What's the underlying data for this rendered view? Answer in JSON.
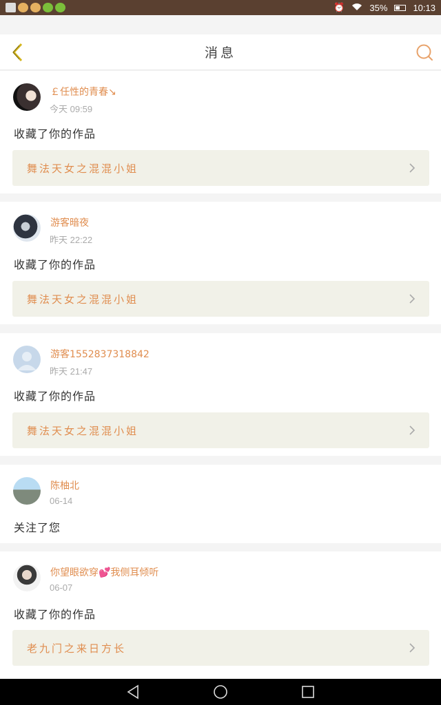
{
  "status": {
    "battery": "35%",
    "time": "10:13"
  },
  "header": {
    "title": "消息"
  },
  "messages": [
    {
      "user": "￡任性的青春↘",
      "time": "今天 09:59",
      "action": "收藏了你的作品",
      "work": "舞法天女之混混小姐"
    },
    {
      "user": "游客暗夜",
      "time": "昨天 22:22",
      "action": "收藏了你的作品",
      "work": "舞法天女之混混小姐"
    },
    {
      "user": "游客1552837318842",
      "time": "昨天 21:47",
      "action": "收藏了你的作品",
      "work": "舞法天女之混混小姐"
    },
    {
      "user": "陈柚北",
      "time": "06-14",
      "action": "关注了您"
    },
    {
      "user": "你望眼欲穿💕我侧耳倾听",
      "time": "06-07",
      "action": "收藏了你的作品",
      "work": "老九门之来日方长"
    }
  ],
  "colors": {
    "accent": "#e08d4f",
    "link_bg": "#f1f1e8",
    "back_icon": "#d4b51e"
  }
}
